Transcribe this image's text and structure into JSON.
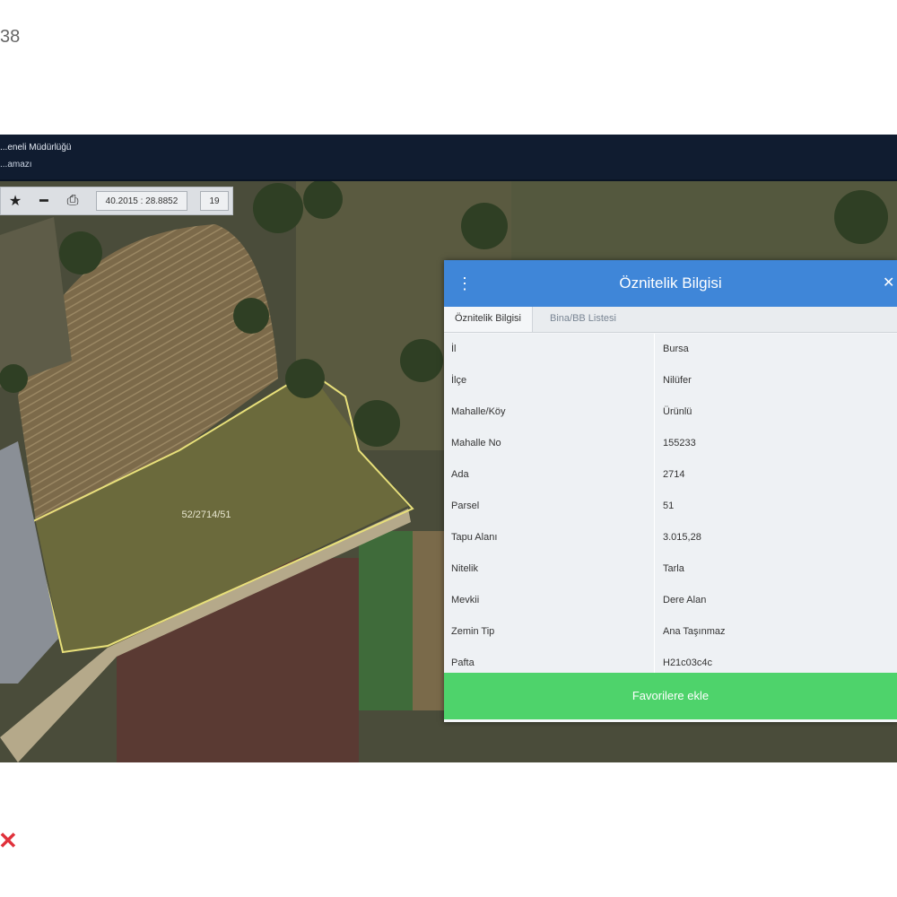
{
  "corner_text": "38",
  "app": {
    "header_line1": "...eneli Müdürlüğü",
    "header_line2": "...amazı"
  },
  "toolbar": {
    "star_icon": "star-icon",
    "minus_icon": "minus-icon",
    "print_icon": "print-icon",
    "coords": "40.2015 : 28.8852",
    "zoom": "19"
  },
  "map": {
    "parcel_label": "52/2714/51"
  },
  "panel": {
    "title": "Öznitelik Bilgisi",
    "tabs": [
      "Öznitelik Bilgisi",
      "Bina/BB Listesi"
    ],
    "rows": [
      {
        "label": "İl",
        "value": "Bursa"
      },
      {
        "label": "İlçe",
        "value": "Nilüfer"
      },
      {
        "label": "Mahalle/Köy",
        "value": "Ürünlü"
      },
      {
        "label": "Mahalle No",
        "value": "155233"
      },
      {
        "label": "Ada",
        "value": "2714"
      },
      {
        "label": "Parsel",
        "value": "51"
      },
      {
        "label": "Tapu Alanı",
        "value": "3.015,28"
      },
      {
        "label": "Nitelik",
        "value": "Tarla"
      },
      {
        "label": "Mevkii",
        "value": "Dere Alan"
      },
      {
        "label": "Zemin Tip",
        "value": "Ana Taşınmaz"
      },
      {
        "label": "Pafta",
        "value": "H21c03c4c"
      }
    ],
    "favorite_button": "Favorilere ekle"
  },
  "colors": {
    "header_blue": "#3f86d8",
    "button_green": "#4ed36b",
    "topbar_navy": "#101c30",
    "parcel_outline": "#e8e07a"
  }
}
